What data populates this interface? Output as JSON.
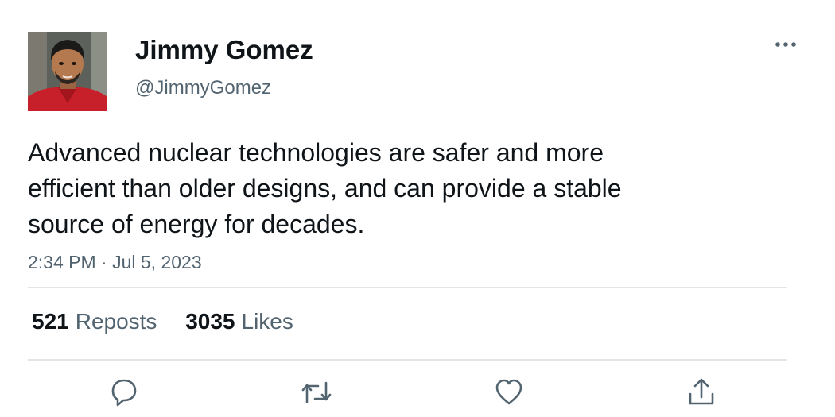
{
  "author": {
    "display_name": "Jimmy Gomez",
    "handle": "@JimmyGomez",
    "avatar_icon": "profile-photo"
  },
  "tweet": {
    "text_lines": [
      "Advanced nuclear technologies are safer and more",
      "efficient than older designs, and can provide a stable",
      "source of energy for decades."
    ],
    "timestamp": "2:34 PM · Jul 5, 2023"
  },
  "stats": {
    "reposts_count": "521",
    "reposts_label": "Reposts",
    "likes_count": "3035",
    "likes_label": "Likes"
  },
  "actions": [
    "reply-icon",
    "repost-icon",
    "like-icon",
    "share-icon"
  ],
  "colors": {
    "text": "#0f1419",
    "secondary_text": "#536471",
    "divider": "#e3e6e8"
  }
}
